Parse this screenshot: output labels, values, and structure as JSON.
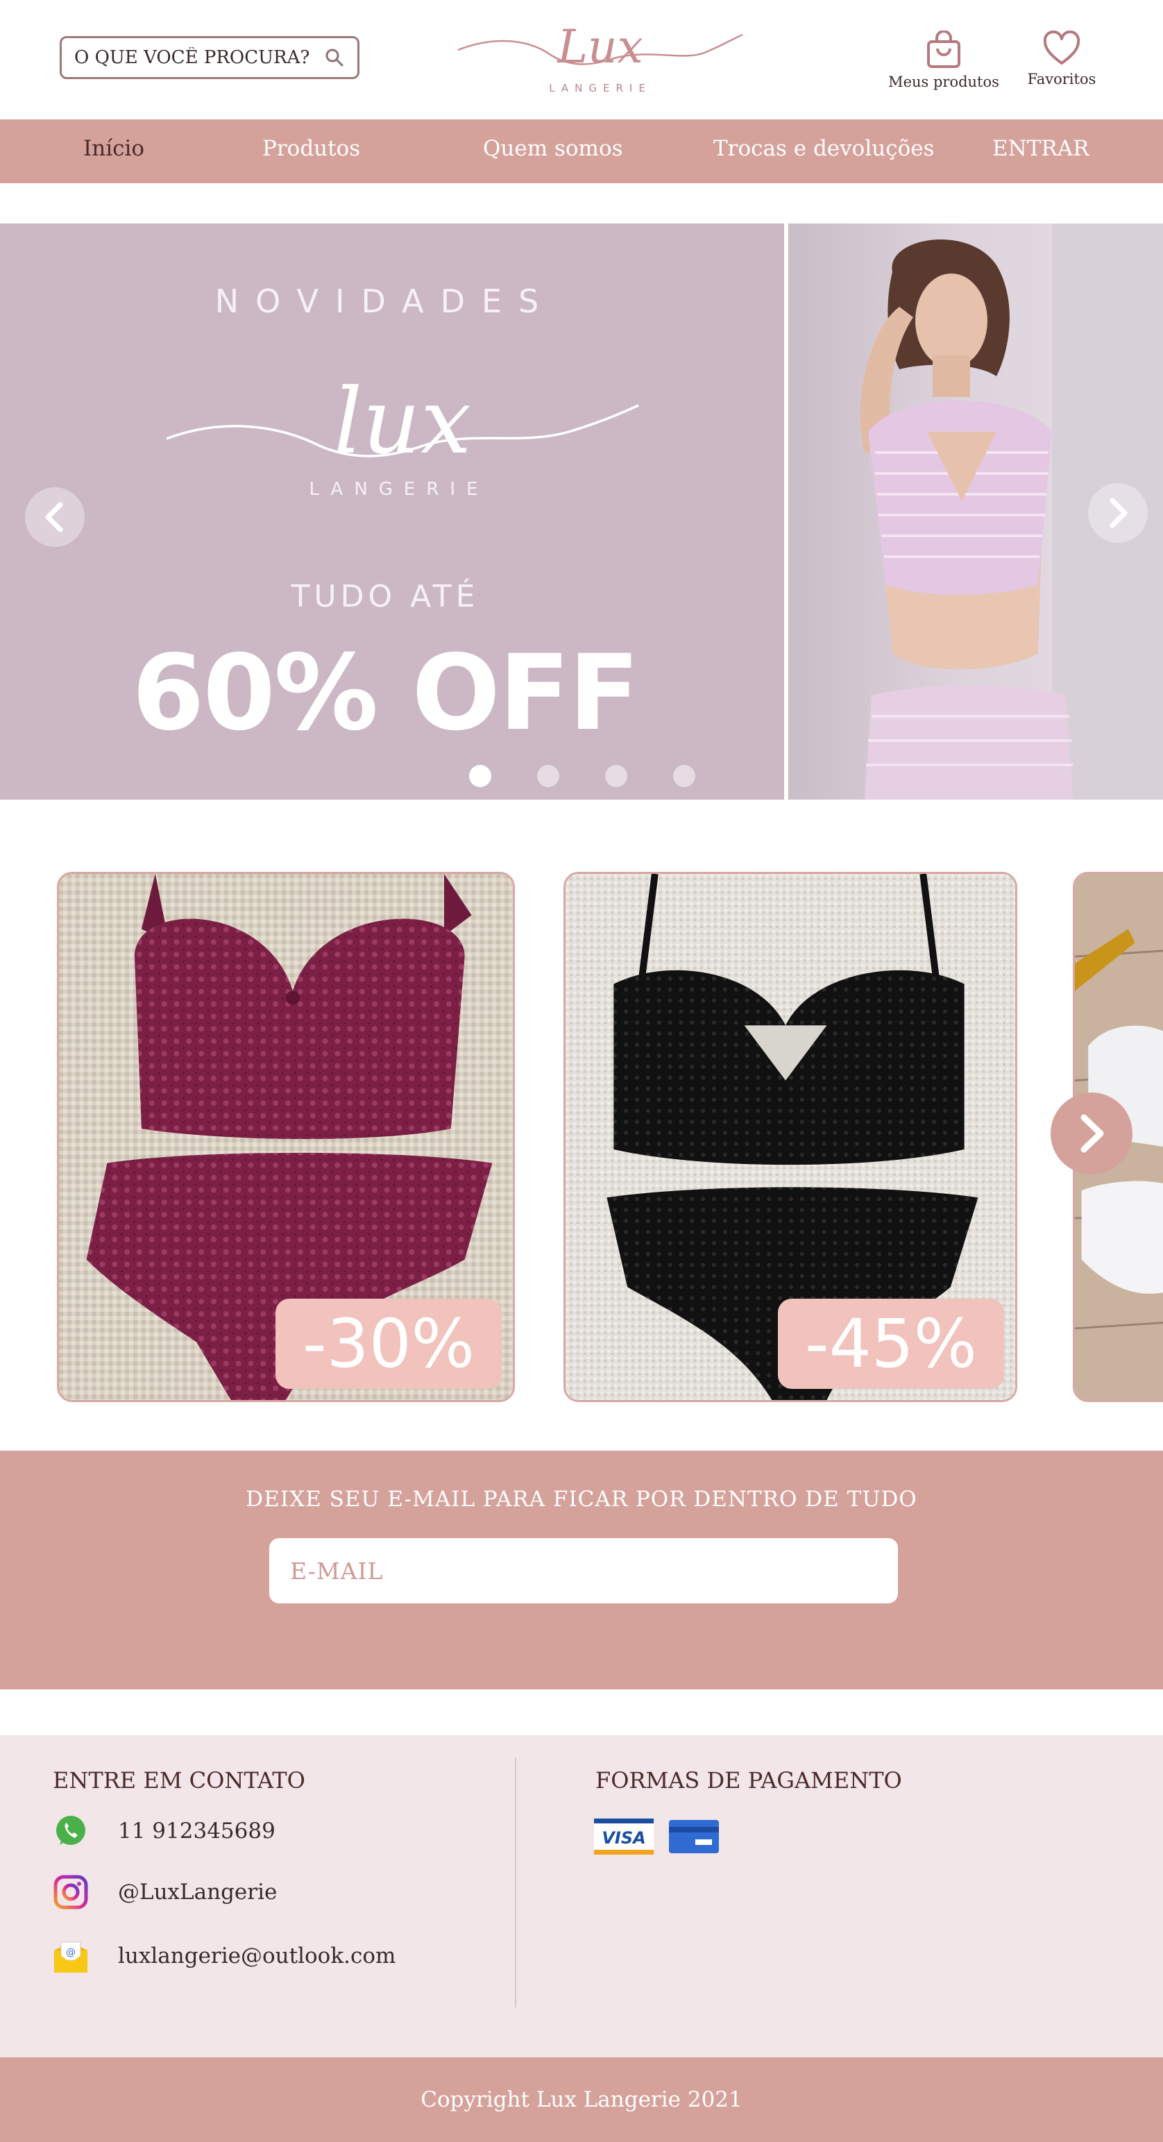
{
  "header": {
    "search": {
      "placeholder": "O QUE VOCÊ PROCURA?",
      "value": ""
    },
    "logo": {
      "script": "Lux",
      "sub": "LANGERIE"
    },
    "my_products_label": "Meus produtos",
    "favorites_label": "Favoritos"
  },
  "nav": {
    "items": [
      {
        "label": "Início",
        "active": true
      },
      {
        "label": "Produtos",
        "active": false
      },
      {
        "label": "Quem somos",
        "active": false
      },
      {
        "label": "Trocas e devoluções",
        "active": false
      },
      {
        "label": "ENTRAR",
        "active": false
      }
    ]
  },
  "hero": {
    "kicker": "NOVIDADES",
    "logo_script": "lux",
    "logo_sub": "LANGERIE",
    "pre": "TUDO ATÉ",
    "big": "60% OFF",
    "slide_count": 4,
    "active_slide": 1
  },
  "products": [
    {
      "discount": "-30%",
      "color": "burgundy"
    },
    {
      "discount": "-45%",
      "color": "black"
    },
    {
      "discount": "",
      "color": "white"
    }
  ],
  "newsletter": {
    "title": "DEIXE SEU E-MAIL PARA FICAR POR DENTRO DE TUDO",
    "placeholder": "E-MAIL"
  },
  "footer": {
    "contact_title": "ENTRE EM CONTATO",
    "phone": "11 912345689",
    "instagram": "@LuxLangerie",
    "email": "luxlangerie@outlook.com",
    "payment_title": "FORMAS DE PAGAMENTO",
    "payment_methods": [
      "VISA",
      "card"
    ]
  },
  "copyright": "Copyright Lux Langerie 2021",
  "colors": {
    "brand_rose": "#d5a19b",
    "hero_mauve": "#ccb8c5",
    "badge_pink": "#f1c3bc",
    "footer_bg": "#f2e6e8"
  }
}
